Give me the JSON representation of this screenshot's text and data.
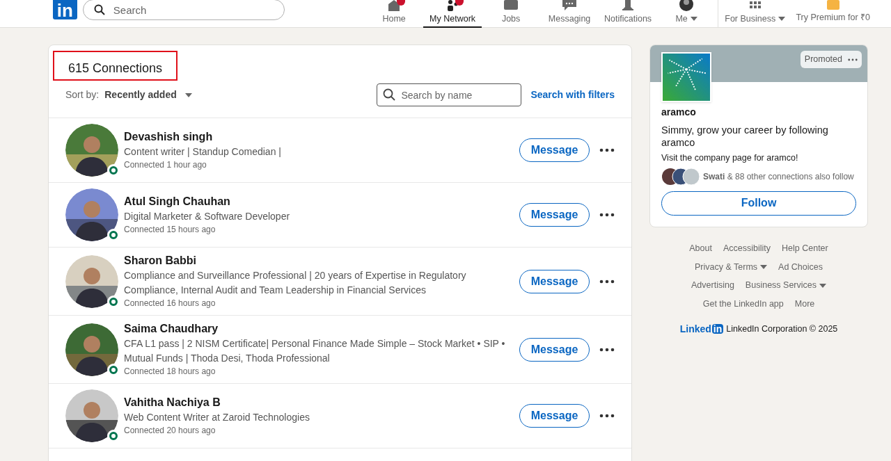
{
  "header": {
    "logo": "in",
    "search_placeholder": "Search",
    "nav": [
      {
        "label": "Home",
        "kind": "home",
        "badge": true,
        "selected": false,
        "dropdown": false
      },
      {
        "label": "My Network",
        "kind": "network",
        "badge": true,
        "selected": true,
        "dropdown": false
      },
      {
        "label": "Jobs",
        "kind": "jobs",
        "badge": false,
        "selected": false,
        "dropdown": false
      },
      {
        "label": "Messaging",
        "kind": "messaging",
        "badge": false,
        "selected": false,
        "dropdown": false
      },
      {
        "label": "Notifications",
        "kind": "notifications",
        "badge": false,
        "selected": false,
        "dropdown": false
      },
      {
        "label": "Me",
        "kind": "profile",
        "badge": false,
        "selected": false,
        "dropdown": true
      }
    ],
    "business": {
      "label": "For Business",
      "dropdown": true
    },
    "premium": "Try Premium for ₹0"
  },
  "connections": {
    "title": "615 Connections",
    "highlighted": true,
    "sort_label": "Sort by:",
    "sort_value": "Recently added",
    "search_placeholder": "Search by name",
    "filters_link": "Search with filters",
    "rows": [
      {
        "name": "Devashish singh",
        "headline": "Content writer | Standup Comedian |",
        "connected": "Connected 1 hour ago",
        "online": true,
        "button": "Message"
      },
      {
        "name": "Atul Singh Chauhan",
        "headline": "Digital Marketer & Software Developer",
        "connected": "Connected 15 hours ago",
        "online": true,
        "button": "Message"
      },
      {
        "name": "Sharon Babbi",
        "headline": "Compliance and Surveillance Professional | 20 years of Expertise in Regulatory Compliance, Internal Audit and Team Leadership in Financial Services",
        "connected": "Connected 16 hours ago",
        "online": true,
        "button": "Message"
      },
      {
        "name": "Saima Chaudhary",
        "headline": "CFA L1 pass | 2 NISM Certificate| Personal Finance Made Simple – Stock Market • SIP • Mutual Funds | Thoda Desi, Thoda Professional",
        "connected": "Connected 18 hours ago",
        "online": true,
        "button": "Message"
      },
      {
        "name": "Vahitha Nachiya B",
        "headline": "Web Content Writer at Zaroid Technologies",
        "connected": "Connected 20 hours ago",
        "online": true,
        "button": "Message"
      }
    ]
  },
  "ad": {
    "badge": "Promoted",
    "company": "aramco",
    "headline": "Simmy, grow your career by following aramco",
    "subtext": "Visit the company page for aramco!",
    "followers": "**Swati** & 88 other connections also follow",
    "button": "Follow"
  },
  "footer": {
    "link_rows": [
      [
        {
          "label": "About",
          "dropdown": false
        },
        {
          "label": "Accessibility",
          "dropdown": false
        },
        {
          "label": "Help Center",
          "dropdown": false
        }
      ],
      [
        {
          "label": "Privacy & Terms",
          "dropdown": true
        },
        {
          "label": "Ad Choices",
          "dropdown": false
        }
      ],
      [
        {
          "label": "Advertising",
          "dropdown": false
        },
        {
          "label": "Business Services",
          "dropdown": true
        }
      ],
      [
        {
          "label": "Get the LinkedIn app",
          "dropdown": false
        },
        {
          "label": "More",
          "dropdown": false
        }
      ]
    ],
    "brand_word": "Linked",
    "brand_mark": "in",
    "copyright": "LinkedIn Corporation © 2025"
  }
}
